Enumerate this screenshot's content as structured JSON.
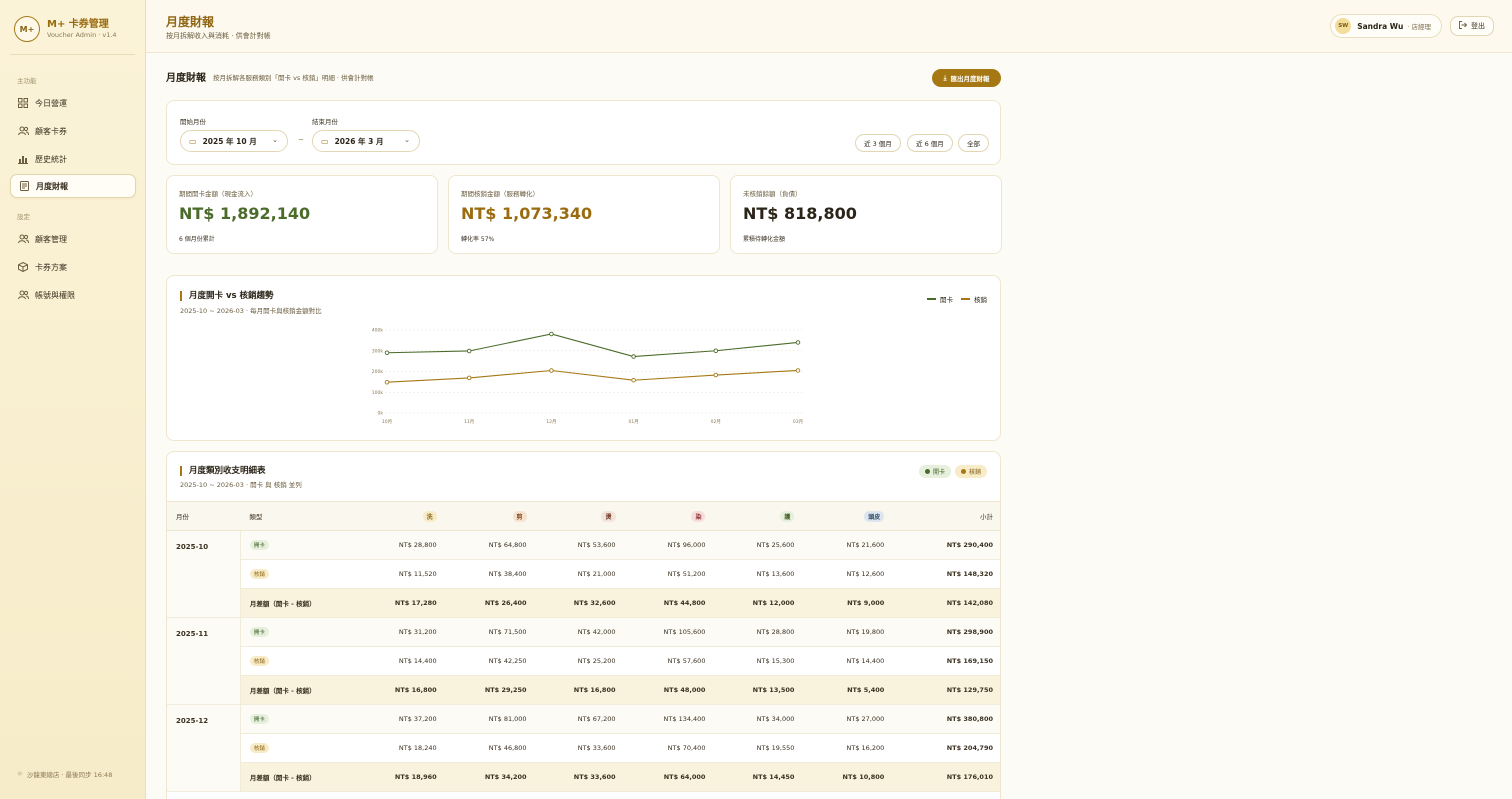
{
  "brand": {
    "logo": "M+",
    "name": "M+ 卡券管理",
    "sub": "Voucher Admin · v1.4"
  },
  "sidebar": {
    "section_main": "主功能",
    "section_settings": "設定",
    "main_items": [
      {
        "label": "今日營運",
        "icon": "dashboard-icon"
      },
      {
        "label": "顧客卡券",
        "icon": "users-icon"
      },
      {
        "label": "歷史統計",
        "icon": "bar-chart-icon"
      },
      {
        "label": "月度財報",
        "icon": "document-icon"
      }
    ],
    "settings_items": [
      {
        "label": "顧客管理",
        "icon": "users-icon"
      },
      {
        "label": "卡券方案",
        "icon": "box-icon"
      },
      {
        "label": "帳號與權限",
        "icon": "users-icon"
      }
    ],
    "footer": "沙龍東總店 · 最後同步 16:48"
  },
  "header": {
    "title": "月度財報",
    "subtitle": "按月拆解收入與消耗 · 供會計對帳",
    "user_initials": "SW",
    "user_name": "Sandra Wu",
    "user_role": "· 店經理",
    "logout": "登出"
  },
  "main": {
    "title": "月度財報",
    "desc": "按月拆解各服務類別「開卡 vs 核銷」明細 · 供會計對帳",
    "export": "匯出月度財報"
  },
  "filter": {
    "start_label": "開始月份",
    "start_value": "2025 年 10 月",
    "end_label": "結束月份",
    "end_value": "2026 年 3 月",
    "tilde": "~",
    "quick": [
      "近 3 個月",
      "近 6 個月",
      "全部"
    ]
  },
  "kpis": [
    {
      "label": "期間開卡金額（現金流入）",
      "value": "NT$ 1,892,140",
      "note": "6 個月份累計",
      "color": "#4a6b2a"
    },
    {
      "label": "期間核銷金額（服務轉化）",
      "value": "NT$ 1,073,340",
      "note": "轉化率 57%",
      "color": "#9a6c10"
    },
    {
      "label": "未核銷餘額（負債）",
      "value": "NT$ 818,800",
      "note": "累積待轉化金額",
      "color": "#2b2418"
    }
  ],
  "chart": {
    "title": "月度開卡 vs 核銷趨勢",
    "subtitle": "2025-10 ~ 2026-03 · 每月開卡與核銷金額對比",
    "legend_open": "開卡",
    "legend_use": "核銷"
  },
  "chart_data": {
    "type": "line",
    "categories": [
      "10月",
      "11月",
      "12月",
      "01月",
      "02月",
      "03月"
    ],
    "y_ticks": [
      "0k",
      "100k",
      "200k",
      "300k",
      "400k"
    ],
    "ylim": [
      0,
      400000
    ],
    "grid": true,
    "legend": "top-right",
    "series": [
      {
        "name": "開卡",
        "color": "#4a6b2a",
        "values": [
          290400,
          298900,
          380800,
          272000,
          300000,
          340000
        ]
      },
      {
        "name": "核銷",
        "color": "#a67814",
        "values": [
          148320,
          169150,
          204790,
          158000,
          183000,
          205000
        ]
      }
    ]
  },
  "table": {
    "title": "月度類別收支明細表",
    "subtitle": "2025-10 ~ 2026-03 · 開卡 與 核銷 並列",
    "badge_open": "開卡",
    "badge_use": "核銷",
    "col_month": "月份",
    "col_type": "類型",
    "col_subtotal": "小計",
    "categories": [
      {
        "name": "洗",
        "bg": "#f8ebc7",
        "fg": "#8a6414"
      },
      {
        "name": "剪",
        "bg": "#f5e3d2",
        "fg": "#8a4a1a"
      },
      {
        "name": "燙",
        "bg": "#f3e4dc",
        "fg": "#7a4030"
      },
      {
        "name": "染",
        "bg": "#f6dedd",
        "fg": "#8a3030"
      },
      {
        "name": "護",
        "bg": "#e6f0dc",
        "fg": "#3e5c26"
      },
      {
        "name": "頭皮",
        "bg": "#dde6ef",
        "fg": "#34506a"
      }
    ],
    "type_open": "開卡",
    "type_use": "核銷",
    "type_diff": "月差額（開卡 - 核銷）",
    "months": [
      {
        "month": "2025-10",
        "open": [
          "NT$ 28,800",
          "NT$ 64,800",
          "NT$ 53,600",
          "NT$ 96,000",
          "NT$ 25,600",
          "NT$ 21,600",
          "NT$ 290,400"
        ],
        "use": [
          "NT$ 11,520",
          "NT$ 38,400",
          "NT$ 21,000",
          "NT$ 51,200",
          "NT$ 13,600",
          "NT$ 12,600",
          "NT$ 148,320"
        ],
        "diff": [
          "NT$ 17,280",
          "NT$ 26,400",
          "NT$ 32,600",
          "NT$ 44,800",
          "NT$ 12,000",
          "NT$ 9,000",
          "NT$ 142,080"
        ]
      },
      {
        "month": "2025-11",
        "open": [
          "NT$ 31,200",
          "NT$ 71,500",
          "NT$ 42,000",
          "NT$ 105,600",
          "NT$ 28,800",
          "NT$ 19,800",
          "NT$ 298,900"
        ],
        "use": [
          "NT$ 14,400",
          "NT$ 42,250",
          "NT$ 25,200",
          "NT$ 57,600",
          "NT$ 15,300",
          "NT$ 14,400",
          "NT$ 169,150"
        ],
        "diff": [
          "NT$ 16,800",
          "NT$ 29,250",
          "NT$ 16,800",
          "NT$ 48,000",
          "NT$ 13,500",
          "NT$ 5,400",
          "NT$ 129,750"
        ]
      },
      {
        "month": "2025-12",
        "open": [
          "NT$ 37,200",
          "NT$ 81,000",
          "NT$ 67,200",
          "NT$ 134,400",
          "NT$ 34,000",
          "NT$ 27,000",
          "NT$ 380,800"
        ],
        "use": [
          "NT$ 18,240",
          "NT$ 46,800",
          "NT$ 33,600",
          "NT$ 70,400",
          "NT$ 19,550",
          "NT$ 16,200",
          "NT$ 204,790"
        ],
        "diff": [
          "NT$ 18,960",
          "NT$ 34,200",
          "NT$ 33,600",
          "NT$ 64,000",
          "NT$ 14,450",
          "NT$ 10,800",
          "NT$ 176,010"
        ]
      }
    ]
  }
}
